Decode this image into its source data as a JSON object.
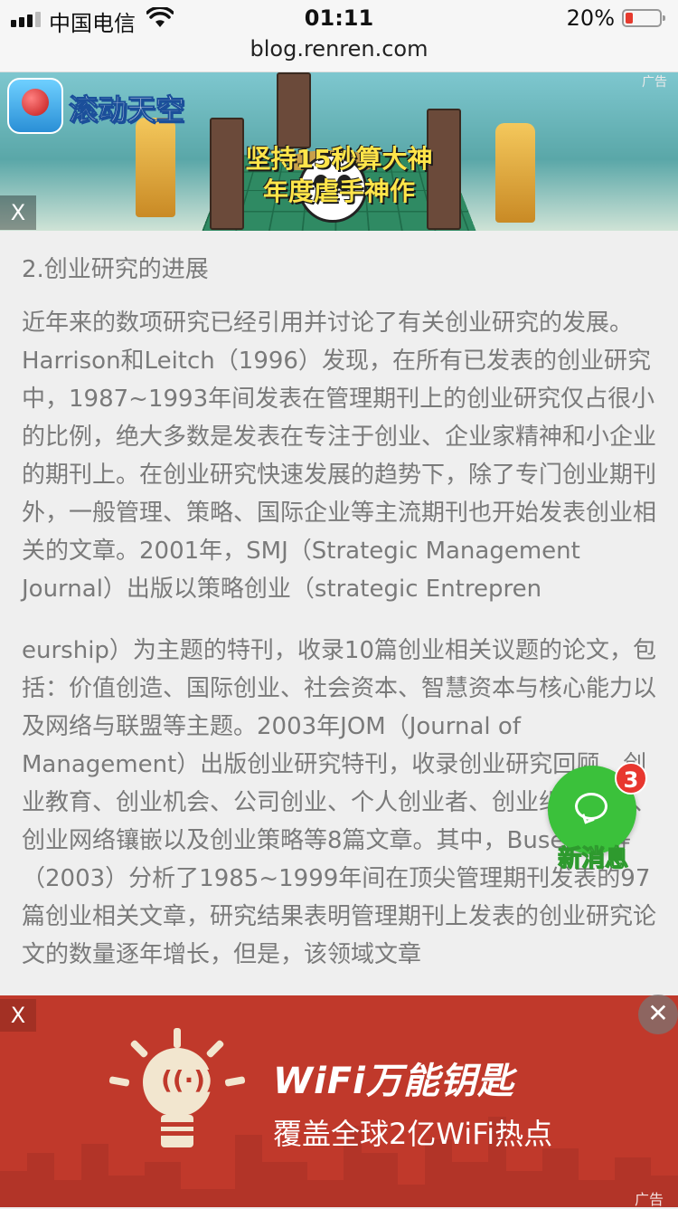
{
  "status_bar": {
    "carrier": "中国电信",
    "time": "01:11",
    "battery_percent": "20%",
    "battery_level": 0.2
  },
  "browser": {
    "url": "blog.renren.com"
  },
  "top_ad": {
    "game_name": "滚动天空",
    "slogan_line1": "坚持15秒算大神",
    "slogan_line2": "年度虐手神作",
    "ad_label": "广告",
    "close_label": "X"
  },
  "article": {
    "heading": "2.创业研究的进展",
    "paragraphs": [
      "近年来的数项研究已经引用并讨论了有关创业研究的发展。Harrison和Leitch（1996）发现，在所有已发表的创业研究中，1987~1993年间发表在管理期刊上的创业研究仅占很小的比例，绝大多数是发表在专注于创业、企业家精神和小企业的期刊上。在创业研究快速发展的趋势下，除了专门创业期刊外，一般管理、策略、国际企业等主流期刊也开始发表创业相关的文章。2001年，SMJ（Strategic Management Journal）出版以策略创业（strategic Entrepren",
      "eurship）为主题的特刊，收录10篇创业相关议题的论文，包括：价值创造、国际创业、社会资本、智慧资本与核心能力以及网络与联盟等主题。2003年JOM（Journal of Management）出版创业研究特刊，收录创业研究回顾、创业教育、创业机会、公司创业、个人创业者、创业组织模式、创业网络镶嵌以及创业策略等8篇文章。其中，Busenitz等（2003）分析了1985~1999年间在顶尖管理期刊发表的97篇创业相关文章，研究结果表明管理期刊上发表的创业研究论文的数量逐年增长，但是，该领域文章"
    ]
  },
  "floating_button": {
    "label": "新消息",
    "badge_count": "3"
  },
  "bottom_ad": {
    "brand": "WiFi万能钥匙",
    "tagline": "覆盖全球2亿WiFi热点",
    "ad_label": "广告",
    "close_label": "X",
    "dismiss_label": "✕"
  },
  "colors": {
    "ad_red": "#c0392b",
    "message_green": "#3bc13b",
    "badge_red": "#e8372f",
    "body_text": "#7a7a7a"
  }
}
